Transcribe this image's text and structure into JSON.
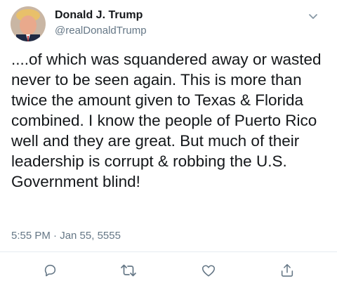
{
  "user": {
    "display_name": "Donald J. Trump",
    "handle": "@realDonaldTrump"
  },
  "tweet": {
    "text": "....of which was squandered away or wasted never to be seen again. This is more than twice the amount given to Texas & Florida combined. I know the people of Puerto Rico well and they are great. But much of their leadership is corrupt & robbing the U.S. Government blind!",
    "timestamp": "5:55 PM · Jan 55, 5555"
  },
  "actions": [
    {
      "icon": "reply-icon"
    },
    {
      "icon": "retweet-icon"
    },
    {
      "icon": "like-icon"
    },
    {
      "icon": "share-icon"
    }
  ],
  "colors": {
    "text": "#14171a",
    "secondary": "#657786",
    "divider": "#e6ecf0"
  }
}
